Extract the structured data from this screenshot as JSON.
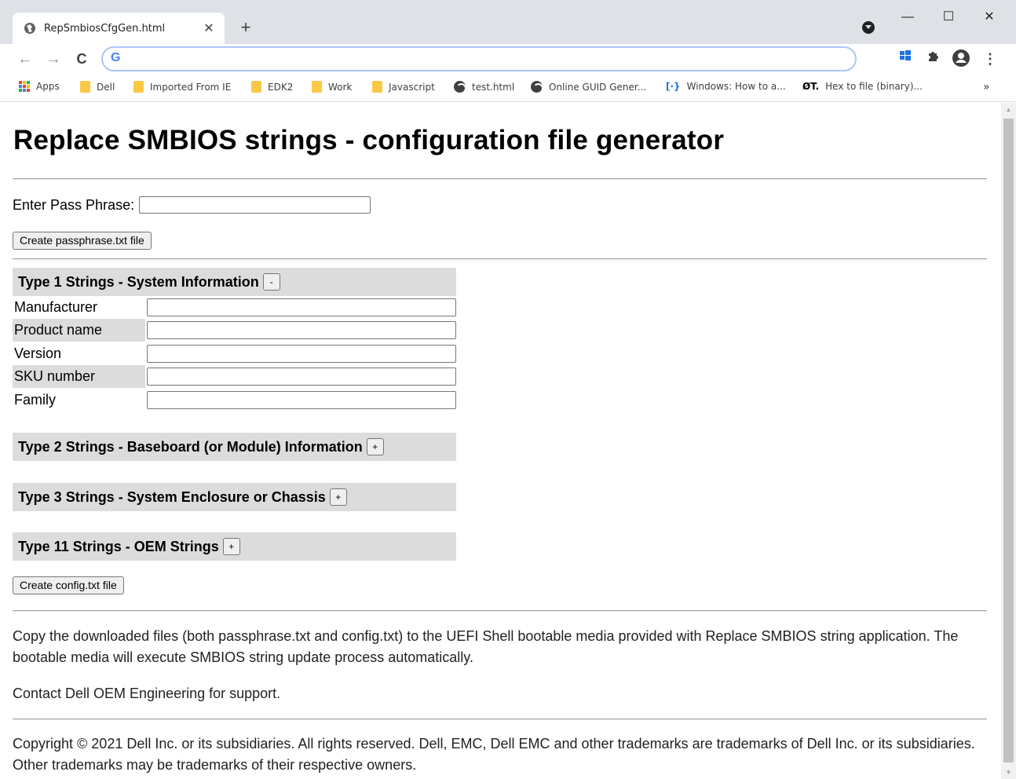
{
  "browser": {
    "tab_title": "RepSmbiosCfgGen.html",
    "tab_close": "✕",
    "new_tab": "+",
    "window_controls": {
      "minimize": "—",
      "maximize": "☐",
      "close": "✕"
    },
    "nav": {
      "back": "←",
      "forward": "→",
      "reload": "C"
    },
    "omnibox_icon": "G",
    "omnibox_value": "",
    "more_menu": "⋮",
    "bookmarks": [
      {
        "label": "Apps",
        "icon": "apps-grid-icon"
      },
      {
        "label": "Dell",
        "icon": "folder-icon"
      },
      {
        "label": "Imported From IE",
        "icon": "folder-icon"
      },
      {
        "label": "EDK2",
        "icon": "folder-icon"
      },
      {
        "label": "Work",
        "icon": "folder-icon"
      },
      {
        "label": "Javascript",
        "icon": "folder-icon"
      },
      {
        "label": "test.html",
        "icon": "globe-icon"
      },
      {
        "label": "Online GUID Gener...",
        "icon": "globe-icon"
      },
      {
        "label": "Windows: How to a...",
        "icon": "bracket-icon",
        "icon_text": "[·}"
      },
      {
        "label": "Hex to file (binary)...",
        "icon": "ot-icon",
        "icon_text": "ØT."
      }
    ],
    "bookmarks_overflow": "»"
  },
  "page": {
    "title": "Replace SMBIOS strings - configuration file generator",
    "pass_phrase_label": "Enter Pass Phrase:",
    "pass_phrase_value": "",
    "create_passphrase_button": "Create passphrase.txt file",
    "sections": [
      {
        "title": "Type 1 Strings - System Information",
        "toggle": "-",
        "fields": [
          {
            "label": "Manufacturer",
            "value": ""
          },
          {
            "label": "Product name",
            "value": ""
          },
          {
            "label": "Version",
            "value": ""
          },
          {
            "label": "SKU number",
            "value": ""
          },
          {
            "label": "Family",
            "value": ""
          }
        ]
      },
      {
        "title": "Type 2 Strings - Baseboard (or Module) Information",
        "toggle": "+"
      },
      {
        "title": "Type 3 Strings - System Enclosure or Chassis",
        "toggle": "+"
      },
      {
        "title": "Type 11 Strings - OEM Strings",
        "toggle": "+"
      }
    ],
    "create_config_button": "Create config.txt file",
    "instructions": "Copy the downloaded files (both passphrase.txt and config.txt) to the UEFI Shell bootable media provided with Replace SMBIOS string application. The bootable media will execute SMBIOS string update process automatically.",
    "support": "Contact Dell OEM Engineering for support.",
    "copyright": "Copyright © 2021 Dell Inc. or its subsidiaries. All rights reserved. Dell, EMC, Dell EMC and other trademarks are trademarks of Dell Inc. or its subsidiaries. Other trademarks may be trademarks of their respective owners."
  },
  "colors": {
    "chrome_bg": "#dee1e6",
    "section_header_bg": "#dcdcdc",
    "button_bg": "#efefef",
    "omnibox_focus": "#a8c7fa"
  }
}
